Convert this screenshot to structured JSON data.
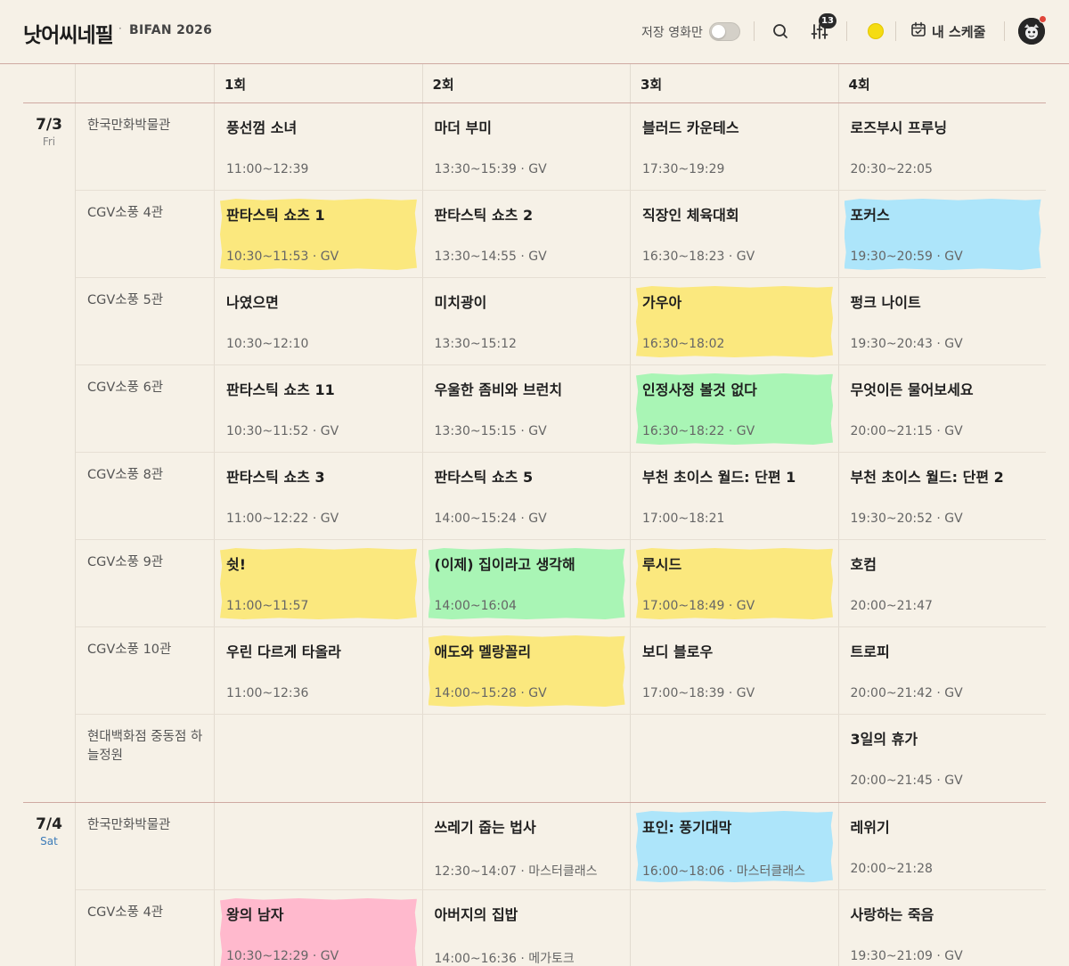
{
  "header": {
    "brand": "낫어씨네필",
    "brand_separator": "·",
    "event": "BIFAN 2026",
    "saved_only_label": "저장 영화만",
    "saved_only_on": false,
    "filter_count": "13",
    "my_schedule_label": "내 스케줄",
    "theme_color": "#f5dc12",
    "icons": [
      "search-icon",
      "filter-sliders-icon",
      "theme-sun-icon",
      "calendar-icon",
      "avatar"
    ]
  },
  "rounds": [
    "1회",
    "2회",
    "3회",
    "4회"
  ],
  "colors": {
    "yellow": "#fbe87e",
    "blue": "#ade5fa",
    "green": "#a9f5b5",
    "pink": "#ffb9cd",
    "accent_line": "#cfa9a2"
  },
  "days": [
    {
      "date": "7/3",
      "dow": "Fri",
      "rows": [
        {
          "venue": "한국만화박물관",
          "cells": [
            {
              "title": "풍선껌 소녀",
              "time": "11:00~12:39",
              "tag": "",
              "hl": ""
            },
            {
              "title": "마더 부미",
              "time": "13:30~15:39",
              "tag": "GV",
              "hl": ""
            },
            {
              "title": "블러드 카운테스",
              "time": "17:30~19:29",
              "tag": "",
              "hl": ""
            },
            {
              "title": "로즈부시 프루닝",
              "time": "20:30~22:05",
              "tag": "",
              "hl": ""
            }
          ]
        },
        {
          "venue": "CGV소풍 4관",
          "cells": [
            {
              "title": "판타스틱 쇼츠 1",
              "time": "10:30~11:53",
              "tag": "GV",
              "hl": "yellow"
            },
            {
              "title": "판타스틱 쇼츠 2",
              "time": "13:30~14:55",
              "tag": "GV",
              "hl": ""
            },
            {
              "title": "직장인 체육대회",
              "time": "16:30~18:23",
              "tag": "GV",
              "hl": ""
            },
            {
              "title": "포커스",
              "time": "19:30~20:59",
              "tag": "GV",
              "hl": "blue"
            }
          ]
        },
        {
          "venue": "CGV소풍 5관",
          "cells": [
            {
              "title": "나였으면",
              "time": "10:30~12:10",
              "tag": "",
              "hl": ""
            },
            {
              "title": "미치광이",
              "time": "13:30~15:12",
              "tag": "",
              "hl": ""
            },
            {
              "title": "가우아",
              "time": "16:30~18:02",
              "tag": "",
              "hl": "yellow"
            },
            {
              "title": "펑크 나이트",
              "time": "19:30~20:43",
              "tag": "GV",
              "hl": ""
            }
          ]
        },
        {
          "venue": "CGV소풍 6관",
          "cells": [
            {
              "title": "판타스틱 쇼츠 11",
              "time": "10:30~11:52",
              "tag": "GV",
              "hl": ""
            },
            {
              "title": "우울한 좀비와 브런치",
              "time": "13:30~15:15",
              "tag": "GV",
              "hl": ""
            },
            {
              "title": "인정사정 볼것 없다",
              "time": "16:30~18:22",
              "tag": "GV",
              "hl": "green"
            },
            {
              "title": "무엇이든 물어보세요",
              "time": "20:00~21:15",
              "tag": "GV",
              "hl": ""
            }
          ]
        },
        {
          "venue": "CGV소풍 8관",
          "cells": [
            {
              "title": "판타스틱 쇼츠 3",
              "time": "11:00~12:22",
              "tag": "GV",
              "hl": ""
            },
            {
              "title": "판타스틱 쇼츠 5",
              "time": "14:00~15:24",
              "tag": "GV",
              "hl": ""
            },
            {
              "title": "부천 초이스 월드: 단편 1",
              "time": "17:00~18:21",
              "tag": "",
              "hl": ""
            },
            {
              "title": "부천 초이스 월드: 단편 2",
              "time": "19:30~20:52",
              "tag": "GV",
              "hl": ""
            }
          ]
        },
        {
          "venue": "CGV소풍 9관",
          "cells": [
            {
              "title": "쉿!",
              "time": "11:00~11:57",
              "tag": "",
              "hl": "yellow"
            },
            {
              "title": "(이제) 집이라고 생각해",
              "time": "14:00~16:04",
              "tag": "",
              "hl": "green"
            },
            {
              "title": "루시드",
              "time": "17:00~18:49",
              "tag": "GV",
              "hl": "yellow"
            },
            {
              "title": "호컴",
              "time": "20:00~21:47",
              "tag": "",
              "hl": ""
            }
          ]
        },
        {
          "venue": "CGV소풍 10관",
          "cells": [
            {
              "title": "우린 다르게 타올라",
              "time": "11:00~12:36",
              "tag": "",
              "hl": ""
            },
            {
              "title": "애도와 멜랑꼴리",
              "time": "14:00~15:28",
              "tag": "GV",
              "hl": "yellow"
            },
            {
              "title": "보디 블로우",
              "time": "17:00~18:39",
              "tag": "GV",
              "hl": ""
            },
            {
              "title": "트로피",
              "time": "20:00~21:42",
              "tag": "GV",
              "hl": ""
            }
          ]
        },
        {
          "venue": "현대백화점 중동점 하늘정원",
          "cells": [
            null,
            null,
            null,
            {
              "title": "3일의 휴가",
              "time": "20:00~21:45",
              "tag": "GV",
              "hl": ""
            }
          ]
        }
      ]
    },
    {
      "date": "7/4",
      "dow": "Sat",
      "rows": [
        {
          "venue": "한국만화박물관",
          "cells": [
            null,
            {
              "title": "쓰레기 줍는 법사",
              "time": "12:30~14:07",
              "tag": "마스터클래스",
              "hl": ""
            },
            {
              "title": "표인: 풍기대막",
              "time": "16:00~18:06",
              "tag": "마스터클래스",
              "hl": "blue"
            },
            {
              "title": "레위기",
              "time": "20:00~21:28",
              "tag": "",
              "hl": ""
            }
          ]
        },
        {
          "venue": "CGV소풍 4관",
          "cells": [
            {
              "title": "왕의 남자",
              "time": "10:30~12:29",
              "tag": "GV",
              "hl": "pink"
            },
            {
              "title": "아버지의 집밥",
              "time": "14:00~16:36",
              "tag": "메가토크",
              "hl": ""
            },
            null,
            {
              "title": "사랑하는 죽음",
              "time": "19:30~21:09",
              "tag": "GV",
              "hl": ""
            }
          ]
        }
      ]
    }
  ]
}
